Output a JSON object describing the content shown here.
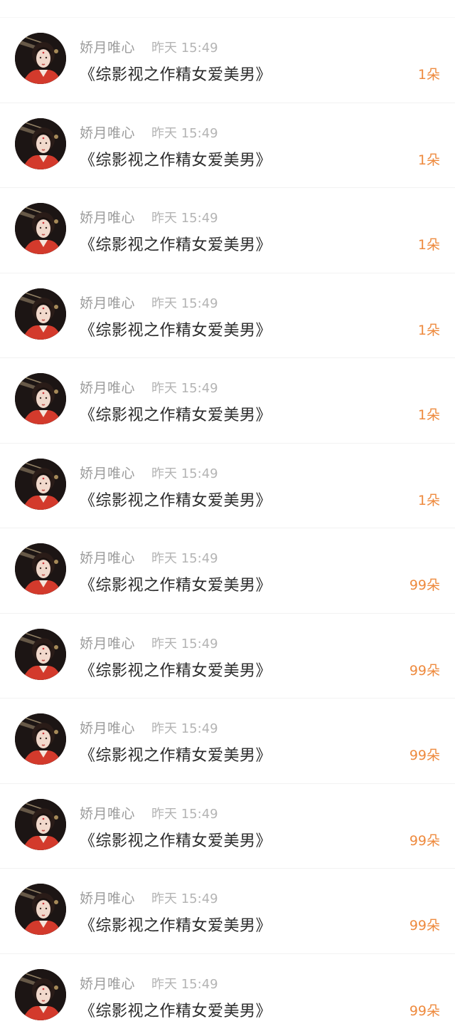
{
  "accent_color": "#ee8a3e",
  "items": [
    {
      "user": "娇月唯心",
      "time": "昨天 15:49",
      "book": "《综影视之作精女爱美男》",
      "flowers": "1朵",
      "avatar_icon": "user-avatar"
    },
    {
      "user": "娇月唯心",
      "time": "昨天 15:49",
      "book": "《综影视之作精女爱美男》",
      "flowers": "1朵",
      "avatar_icon": "user-avatar"
    },
    {
      "user": "娇月唯心",
      "time": "昨天 15:49",
      "book": "《综影视之作精女爱美男》",
      "flowers": "1朵",
      "avatar_icon": "user-avatar"
    },
    {
      "user": "娇月唯心",
      "time": "昨天 15:49",
      "book": "《综影视之作精女爱美男》",
      "flowers": "1朵",
      "avatar_icon": "user-avatar"
    },
    {
      "user": "娇月唯心",
      "time": "昨天 15:49",
      "book": "《综影视之作精女爱美男》",
      "flowers": "1朵",
      "avatar_icon": "user-avatar"
    },
    {
      "user": "娇月唯心",
      "time": "昨天 15:49",
      "book": "《综影视之作精女爱美男》",
      "flowers": "1朵",
      "avatar_icon": "user-avatar"
    },
    {
      "user": "娇月唯心",
      "time": "昨天 15:49",
      "book": "《综影视之作精女爱美男》",
      "flowers": "99朵",
      "avatar_icon": "user-avatar"
    },
    {
      "user": "娇月唯心",
      "time": "昨天 15:49",
      "book": "《综影视之作精女爱美男》",
      "flowers": "99朵",
      "avatar_icon": "user-avatar"
    },
    {
      "user": "娇月唯心",
      "time": "昨天 15:49",
      "book": "《综影视之作精女爱美男》",
      "flowers": "99朵",
      "avatar_icon": "user-avatar"
    },
    {
      "user": "娇月唯心",
      "time": "昨天 15:49",
      "book": "《综影视之作精女爱美男》",
      "flowers": "99朵",
      "avatar_icon": "user-avatar"
    },
    {
      "user": "娇月唯心",
      "time": "昨天 15:49",
      "book": "《综影视之作精女爱美男》",
      "flowers": "99朵",
      "avatar_icon": "user-avatar"
    },
    {
      "user": "娇月唯心",
      "time": "昨天 15:49",
      "book": "《综影视之作精女爱美男》",
      "flowers": "99朵",
      "avatar_icon": "user-avatar"
    }
  ]
}
